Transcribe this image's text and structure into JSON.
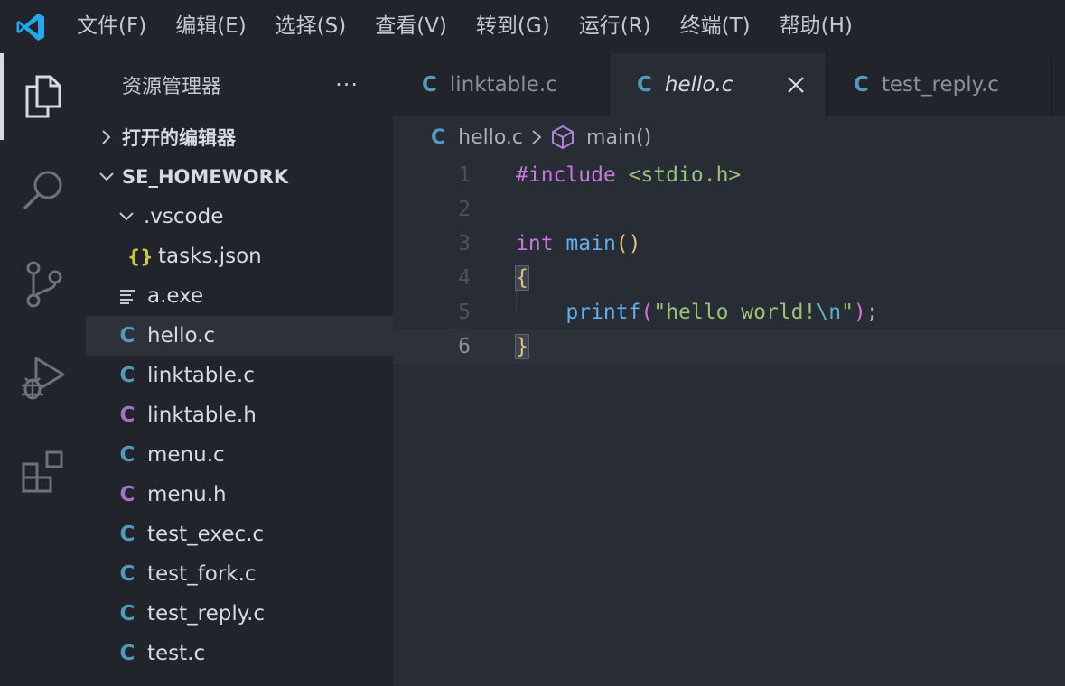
{
  "menu": [
    "文件(F)",
    "编辑(E)",
    "选择(S)",
    "查看(V)",
    "转到(G)",
    "运行(R)",
    "终端(T)",
    "帮助(H)"
  ],
  "sidebar": {
    "title": "资源管理器",
    "more": "···",
    "open_editors": "打开的编辑器",
    "workspace": "SE_HOMEWORK",
    "folder": ".vscode",
    "files": [
      {
        "badge": "{}",
        "kind": "json",
        "name": "tasks.json"
      },
      {
        "badge": "",
        "kind": "exe",
        "name": "a.exe"
      },
      {
        "badge": "C",
        "kind": "c",
        "name": "hello.c"
      },
      {
        "badge": "C",
        "kind": "c",
        "name": "linktable.c"
      },
      {
        "badge": "C",
        "kind": "h",
        "name": "linktable.h"
      },
      {
        "badge": "C",
        "kind": "c",
        "name": "menu.c"
      },
      {
        "badge": "C",
        "kind": "h",
        "name": "menu.h"
      },
      {
        "badge": "C",
        "kind": "c",
        "name": "test_exec.c"
      },
      {
        "badge": "C",
        "kind": "c",
        "name": "test_fork.c"
      },
      {
        "badge": "C",
        "kind": "c",
        "name": "test_reply.c"
      },
      {
        "badge": "C",
        "kind": "c",
        "name": "test.c"
      }
    ]
  },
  "tabs": [
    {
      "badge": "C",
      "label": "linktable.c"
    },
    {
      "badge": "C",
      "label": "hello.c"
    },
    {
      "badge": "C",
      "label": "test_reply.c"
    }
  ],
  "breadcrumb": {
    "badge": "C",
    "file": "hello.c",
    "symbol": "main()"
  },
  "code": {
    "line_numbers": [
      "1",
      "2",
      "3",
      "4",
      "5",
      "6"
    ],
    "include_kw": "#include",
    "include_file": "<stdio.h>",
    "type_kw": "int",
    "fn_name": "main",
    "parens": "()",
    "open_brace": "{",
    "indent": "    ",
    "call": "printf",
    "paren_open": "(",
    "str_part1": "\"hello world!",
    "esc": "\\n",
    "str_part2": "\"",
    "paren_close_semi": ");",
    "close_brace": "}"
  },
  "colors": {
    "c_icon": "#519aba",
    "h_icon": "#a074c4",
    "json_icon": "#cbcb41",
    "keyword": "#c678dd",
    "string": "#98c379",
    "function": "#61afef"
  }
}
